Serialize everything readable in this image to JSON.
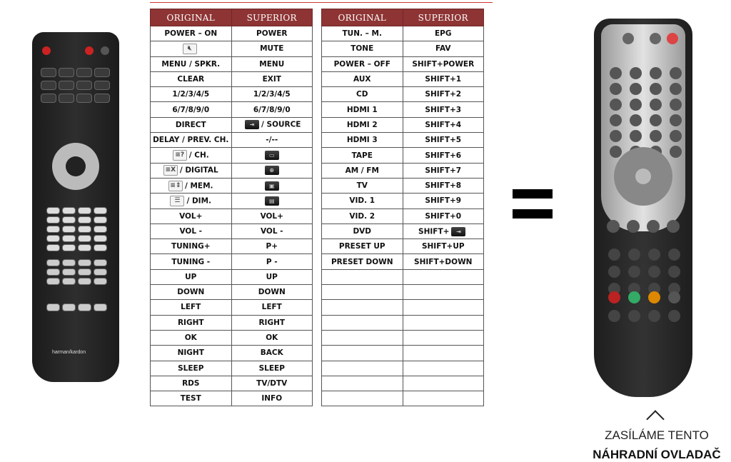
{
  "tables": [
    {
      "headers": [
        "ORIGINAL",
        "SUPERIOR"
      ],
      "rows": [
        {
          "original": "POWER – ON",
          "superior": "POWER"
        },
        {
          "original": "",
          "original_icon": "mute-icon",
          "superior": "MUTE"
        },
        {
          "original": "MENU / SPKR.",
          "superior": "MENU"
        },
        {
          "original": "CLEAR",
          "superior": "EXIT"
        },
        {
          "original": "1/2/3/4/5",
          "superior": "1/2/3/4/5"
        },
        {
          "original": "6/7/8/9/0",
          "superior": "6/7/8/9/0"
        },
        {
          "original": "DIRECT",
          "superior": "/ SOURCE",
          "superior_icon": "source-icon"
        },
        {
          "original": "DELAY / PREV. CH.",
          "superior": "-/--"
        },
        {
          "original": "/ CH.",
          "original_icon": "info-key-icon",
          "superior": "",
          "superior_icon": "teletext-icon"
        },
        {
          "original": "/ DIGITAL",
          "original_icon": "cancel-key-icon",
          "superior": "",
          "superior_icon": "teletext-mix-icon"
        },
        {
          "original": "/ MEM.",
          "original_icon": "updown-key-icon",
          "superior": "",
          "superior_icon": "teletext-size-icon"
        },
        {
          "original": "/ DIM.",
          "original_icon": "list-key-icon",
          "superior": "",
          "superior_icon": "subtitle-icon"
        },
        {
          "original": "VOL+",
          "superior": "VOL+"
        },
        {
          "original": "VOL -",
          "superior": "VOL -"
        },
        {
          "original": "TUNING+",
          "superior": "P+"
        },
        {
          "original": "TUNING -",
          "superior": "P -"
        },
        {
          "original": "UP",
          "superior": "UP"
        },
        {
          "original": "DOWN",
          "superior": "DOWN"
        },
        {
          "original": "LEFT",
          "superior": "LEFT"
        },
        {
          "original": "RIGHT",
          "superior": "RIGHT"
        },
        {
          "original": "OK",
          "superior": "OK"
        },
        {
          "original": "NIGHT",
          "superior": "BACK"
        },
        {
          "original": "SLEEP",
          "superior": "SLEEP"
        },
        {
          "original": "RDS",
          "superior": "TV/DTV"
        },
        {
          "original": "TEST",
          "superior": "INFO"
        }
      ]
    },
    {
      "headers": [
        "ORIGINAL",
        "SUPERIOR"
      ],
      "rows": [
        {
          "original": "TUN. – M.",
          "superior": "EPG"
        },
        {
          "original": "TONE",
          "superior": "FAV"
        },
        {
          "original": "POWER – OFF",
          "superior": "SHIFT+POWER"
        },
        {
          "original": "AUX",
          "superior": "SHIFT+1"
        },
        {
          "original": "CD",
          "superior": "SHIFT+2"
        },
        {
          "original": "HDMI 1",
          "superior": "SHIFT+3"
        },
        {
          "original": "HDMI 2",
          "superior": "SHIFT+4"
        },
        {
          "original": "HDMI 3",
          "superior": "SHIFT+5"
        },
        {
          "original": "TAPE",
          "superior": "SHIFT+6"
        },
        {
          "original": "AM / FM",
          "superior": "SHIFT+7"
        },
        {
          "original": "TV",
          "superior": "SHIFT+8"
        },
        {
          "original": "VID. 1",
          "superior": "SHIFT+9"
        },
        {
          "original": "VID. 2",
          "superior": "SHIFT+0"
        },
        {
          "original": "DVD",
          "superior": "SHIFT+",
          "superior_icon_after": "source-icon"
        },
        {
          "original": "PRESET UP",
          "superior": "SHIFT+UP"
        },
        {
          "original": "PRESET DOWN",
          "superior": "SHIFT+DOWN"
        },
        {
          "original": "",
          "superior": ""
        },
        {
          "original": "",
          "superior": ""
        },
        {
          "original": "",
          "superior": ""
        },
        {
          "original": "",
          "superior": ""
        },
        {
          "original": "",
          "superior": ""
        },
        {
          "original": "",
          "superior": ""
        },
        {
          "original": "",
          "superior": ""
        },
        {
          "original": "",
          "superior": ""
        },
        {
          "original": "",
          "superior": ""
        }
      ]
    }
  ],
  "original_remote": {
    "brand_logo": "harman/kardon"
  },
  "caption": {
    "line1": "ZASÍLÁME TENTO",
    "line2": "NÁHRADNÍ OVLADAČ"
  },
  "colors": {
    "header": "#8e3434",
    "accent_line": "#cc3333"
  }
}
